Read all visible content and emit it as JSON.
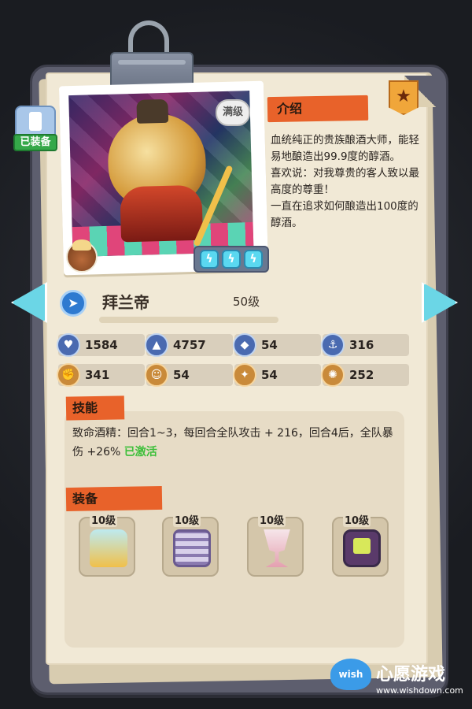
{
  "character": {
    "equipped_label": "已装备",
    "max_label": "满级",
    "name": "拜兰帝",
    "level": "50级"
  },
  "intro": {
    "tag": "介绍",
    "lines": [
      "血统纯正的贵族酿酒大师，能轻易地酿造出99.9度的醇酒。",
      "喜欢说：对我尊贵的客人致以最高度的尊重！",
      "一直在追求如何酿造出100度的醇酒。"
    ]
  },
  "stats": [
    {
      "icon": "heart-icon",
      "value": "1584"
    },
    {
      "icon": "rocket-icon",
      "value": "4757"
    },
    {
      "icon": "shield-icon",
      "value": "54"
    },
    {
      "icon": "anchor-icon",
      "value": "316"
    },
    {
      "icon": "power-icon",
      "value": "341"
    },
    {
      "icon": "smile-icon",
      "value": "54"
    },
    {
      "icon": "muscle-icon",
      "value": "54"
    },
    {
      "icon": "brain-icon",
      "value": "252"
    }
  ],
  "skill": {
    "tag": "技能",
    "text": "致命酒精：回合1~3，每回合全队攻击 + 216，回合4后，全队暴伤 +26%",
    "status": "已激活"
  },
  "equipment": {
    "tag": "装备",
    "items": [
      {
        "icon": "chest-icon",
        "level": "10级"
      },
      {
        "icon": "maze-icon",
        "level": "10级"
      },
      {
        "icon": "goblet-icon",
        "level": "10级"
      },
      {
        "icon": "device-icon",
        "level": "10级"
      }
    ]
  },
  "watermark": {
    "brand": "wish",
    "title": "心愿游戏",
    "url": "www.wishdown.com"
  },
  "colors": {
    "accent_orange": "#e8622a",
    "paper": "#f1e9d6",
    "active_green": "#3dbf3a"
  }
}
